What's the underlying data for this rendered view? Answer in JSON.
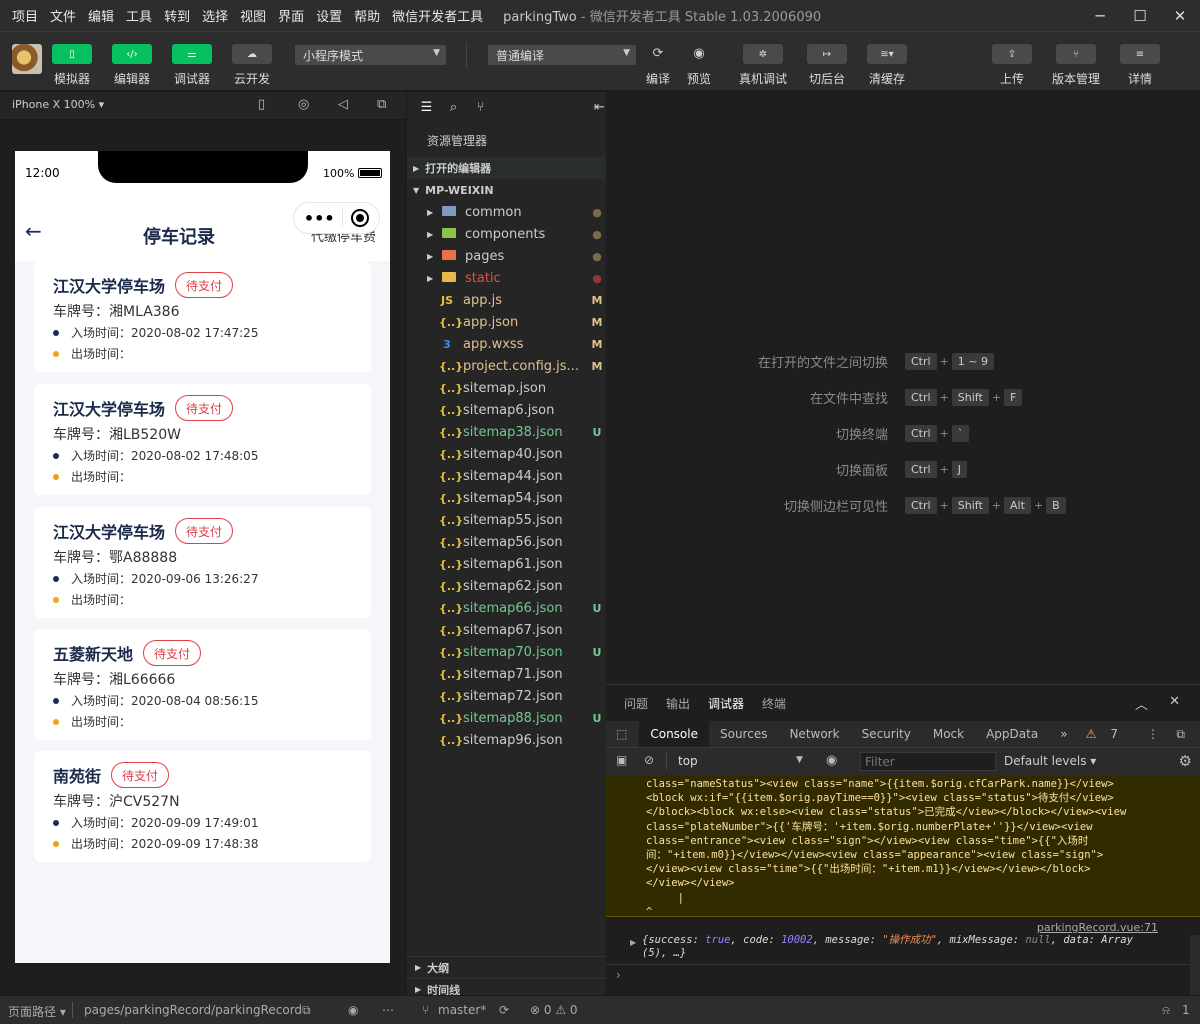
{
  "menu": [
    "项目",
    "文件",
    "编辑",
    "工具",
    "转到",
    "选择",
    "视图",
    "界面",
    "设置",
    "帮助",
    "微信开发者工具"
  ],
  "window": {
    "project": "parkingTwo",
    "app": "微信开发者工具 Stable 1.03.2006090"
  },
  "toolbar": {
    "simulator": "模拟器",
    "editor": "编辑器",
    "debugger": "调试器",
    "cloud": "云开发",
    "mode_select": "小程序模式",
    "compile_select": "普通编译",
    "compile": "编译",
    "preview": "预览",
    "remote_debug": "真机调试",
    "background": "切后台",
    "clear_cache": "清缓存",
    "upload": "上传",
    "version": "版本管理",
    "details": "详情"
  },
  "simulator": {
    "device": "iPhone X 100% ▾"
  },
  "phone": {
    "time": "12:00",
    "battery": "100%",
    "back": "←",
    "title": "停车记录",
    "right_action": "代缴停车费",
    "cards": [
      {
        "park": "江汉大学停车场",
        "status": "待支付",
        "plate": "车牌号：湘MLA386",
        "enter": "入场时间：2020-08-02 17:47:25",
        "exit": "出场时间："
      },
      {
        "park": "江汉大学停车场",
        "status": "待支付",
        "plate": "车牌号：湘LB520W",
        "enter": "入场时间：2020-08-02 17:48:05",
        "exit": "出场时间："
      },
      {
        "park": "江汉大学停车场",
        "status": "待支付",
        "plate": "车牌号：鄂A88888",
        "enter": "入场时间：2020-09-06 13:26:27",
        "exit": "出场时间："
      },
      {
        "park": "五菱新天地",
        "status": "待支付",
        "plate": "车牌号：湘L66666",
        "enter": "入场时间：2020-08-04 08:56:15",
        "exit": "出场时间："
      },
      {
        "park": "南苑街",
        "status": "待支付",
        "plate": "车牌号：沪CV527N",
        "enter": "入场时间：2020-09-09 17:49:01",
        "exit": "出场时间：2020-09-09 17:48:38"
      }
    ]
  },
  "explorer": {
    "header": "资源管理器",
    "open_editors": "打开的编辑器",
    "root": "MP-WEIXIN",
    "items": [
      {
        "name": "common",
        "status": "●",
        "type": "folder",
        "color": "#cccccc",
        "icon_color": "#7f9cc0"
      },
      {
        "name": "components",
        "status": "●",
        "type": "folder",
        "color": "#cccccc",
        "icon_color": "#8bc34a"
      },
      {
        "name": "pages",
        "status": "●",
        "type": "folder",
        "color": "#cccccc",
        "icon_color": "#e8734a"
      },
      {
        "name": "static",
        "status": "●",
        "type": "folder",
        "color": "#e0504a",
        "icon_color": "#e8b84a"
      },
      {
        "name": "app.js",
        "status": "M",
        "type": "js",
        "color": "#e2c08d"
      },
      {
        "name": "app.json",
        "status": "M",
        "type": "json",
        "color": "#e2c08d"
      },
      {
        "name": "app.wxss",
        "status": "M",
        "type": "css",
        "color": "#e2c08d"
      },
      {
        "name": "project.config.js...",
        "status": "M",
        "type": "json",
        "color": "#e2c08d"
      },
      {
        "name": "sitemap.json",
        "status": "",
        "type": "json",
        "color": "#cccccc"
      },
      {
        "name": "sitemap6.json",
        "status": "",
        "type": "json",
        "color": "#cccccc"
      },
      {
        "name": "sitemap38.json",
        "status": "U",
        "type": "json",
        "color": "#73c991"
      },
      {
        "name": "sitemap40.json",
        "status": "",
        "type": "json",
        "color": "#cccccc"
      },
      {
        "name": "sitemap44.json",
        "status": "",
        "type": "json",
        "color": "#cccccc"
      },
      {
        "name": "sitemap54.json",
        "status": "",
        "type": "json",
        "color": "#cccccc"
      },
      {
        "name": "sitemap55.json",
        "status": "",
        "type": "json",
        "color": "#cccccc"
      },
      {
        "name": "sitemap56.json",
        "status": "",
        "type": "json",
        "color": "#cccccc"
      },
      {
        "name": "sitemap61.json",
        "status": "",
        "type": "json",
        "color": "#cccccc"
      },
      {
        "name": "sitemap62.json",
        "status": "",
        "type": "json",
        "color": "#cccccc"
      },
      {
        "name": "sitemap66.json",
        "status": "U",
        "type": "json",
        "color": "#73c991"
      },
      {
        "name": "sitemap67.json",
        "status": "",
        "type": "json",
        "color": "#cccccc"
      },
      {
        "name": "sitemap70.json",
        "status": "U",
        "type": "json",
        "color": "#73c991"
      },
      {
        "name": "sitemap71.json",
        "status": "",
        "type": "json",
        "color": "#cccccc"
      },
      {
        "name": "sitemap72.json",
        "status": "",
        "type": "json",
        "color": "#cccccc"
      },
      {
        "name": "sitemap88.json",
        "status": "U",
        "type": "json",
        "color": "#73c991"
      },
      {
        "name": "sitemap96.json",
        "status": "",
        "type": "json",
        "color": "#cccccc"
      }
    ],
    "outline": "大纲",
    "timeline": "时间线"
  },
  "shortcuts": [
    {
      "label": "在打开的文件之间切换",
      "keys": [
        "Ctrl",
        "1 ~ 9"
      ]
    },
    {
      "label": "在文件中查找",
      "keys": [
        "Ctrl",
        "Shift",
        "F"
      ]
    },
    {
      "label": "切换终端",
      "keys": [
        "Ctrl",
        "`"
      ]
    },
    {
      "label": "切换面板",
      "keys": [
        "Ctrl",
        "J"
      ]
    },
    {
      "label": "切换侧边栏可见性",
      "keys": [
        "Ctrl",
        "Shift",
        "Alt",
        "B"
      ]
    }
  ],
  "debug": {
    "tabs": [
      "问题",
      "输出",
      "调试器",
      "终端"
    ],
    "devtools_tabs": [
      "Console",
      "Sources",
      "Network",
      "Security",
      "Mock",
      "AppData"
    ],
    "warn_count": "7",
    "context": "top",
    "filter_placeholder": "Filter",
    "levels": "Default levels ▾",
    "error_text": "class=\"nameStatus\"><view class=\"name\">{{item.$orig.cfCarPark.name}}</view>\n<block wx:if=\"{{item.$orig.payTime==0}}\"><view class=\"status\">待支付</view>\n</block><block wx:else><view class=\"status\">已完成</view></block></view><view\nclass=\"plateNumber\">{{'车牌号：'+item.$orig.numberPlate+''}}</view><view\nclass=\"entrance\"><view class=\"sign\"></view><view class=\"time\">{{\"入场时\n间：\"+item.m0}}</view></view><view class=\"appearance\"><view class=\"sign\">\n</view><view class=\"time\">{{\"出场时间：\"+item.m1}}</view></view></block>\n</view></view>\n     |\n^",
    "log_source": "parkingRecord.vue:71",
    "log_success": "true",
    "log_code": "10002",
    "log_message": "\"操作成功\"",
    "log_mix": "null",
    "log_tail": "(5), …}"
  },
  "statusbar": {
    "page_path_label": "页面路径 ▾",
    "page_path": "pages/parkingRecord/parkingRecord",
    "branch": "master*",
    "errors": "⊗ 0 ⚠ 0",
    "notif": "1"
  }
}
